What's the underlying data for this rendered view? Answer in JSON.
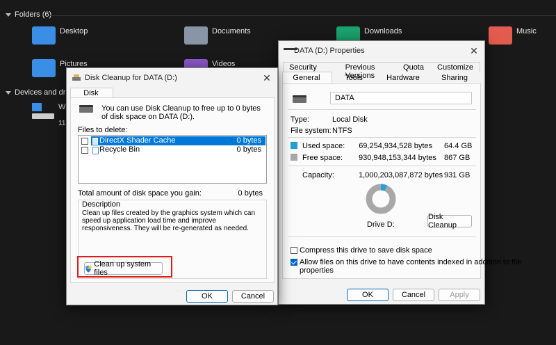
{
  "explorer": {
    "folders_header": "Folders (6)",
    "devices_header": "Devices and drives",
    "device_partial_name": "W",
    "device_partial_detail": "11",
    "folders": [
      {
        "label": "Desktop",
        "color": "#3a8ee6"
      },
      {
        "label": "Documents",
        "color": "#8795a6"
      },
      {
        "label": "Downloads",
        "color": "#1aa36f"
      },
      {
        "label": "Music",
        "color": "#e35b4e"
      },
      {
        "label": "Pictures",
        "color": "#3a8ee6"
      },
      {
        "label": "Videos",
        "color": "#8a56c8"
      }
    ]
  },
  "cleanup": {
    "title": "Disk Cleanup for DATA (D:)",
    "tab": "Disk Cleanup",
    "intro": "You can use Disk Cleanup to free up to 0 bytes of disk space on DATA (D:).",
    "files_to_delete_label": "Files to delete:",
    "files": [
      {
        "name": "DirectX Shader Cache",
        "size": "0 bytes",
        "selected": true,
        "checked": false
      },
      {
        "name": "Recycle Bin",
        "size": "0 bytes",
        "selected": false,
        "checked": false
      }
    ],
    "total_label": "Total amount of disk space you gain:",
    "total_value": "0 bytes",
    "description_label": "Description",
    "description_text": "Clean up files created by the graphics system which can speed up application load time and improve responsiveness. They will be re-generated as needed.",
    "cleanup_system_button": "Clean up system files",
    "ok": "OK",
    "cancel": "Cancel",
    "highlight_color": "#e01b1b"
  },
  "props": {
    "title": "DATA (D:) Properties",
    "tabs_row1": [
      "Security",
      "Previous Versions",
      "Quota",
      "Customize"
    ],
    "tabs_row2": [
      "General",
      "Tools",
      "Hardware",
      "Sharing"
    ],
    "active_tab": "General",
    "drive_name": "DATA",
    "type_label": "Type:",
    "type_value": "Local Disk",
    "fs_label": "File system:",
    "fs_value": "NTFS",
    "used_label": "Used space:",
    "used_bytes": "69,254,934,528 bytes",
    "used_gb": "64.4 GB",
    "free_label": "Free space:",
    "free_bytes": "930,948,153,344 bytes",
    "free_gb": "867 GB",
    "capacity_label": "Capacity:",
    "capacity_bytes": "1,000,203,087,872 bytes",
    "capacity_gb": "931 GB",
    "drive_label": "Drive D:",
    "disk_cleanup_button": "Disk Cleanup",
    "used_fraction": 0.069,
    "used_color": "#26a0da",
    "free_color": "#a8a8a8",
    "compress_label": "Compress this drive to save disk space",
    "compress_checked": false,
    "index_label_line1": "Allow files on this drive to have contents indexed in addition to file",
    "index_label_line2": "properties",
    "index_checked": true,
    "ok": "OK",
    "cancel": "Cancel",
    "apply": "Apply"
  }
}
